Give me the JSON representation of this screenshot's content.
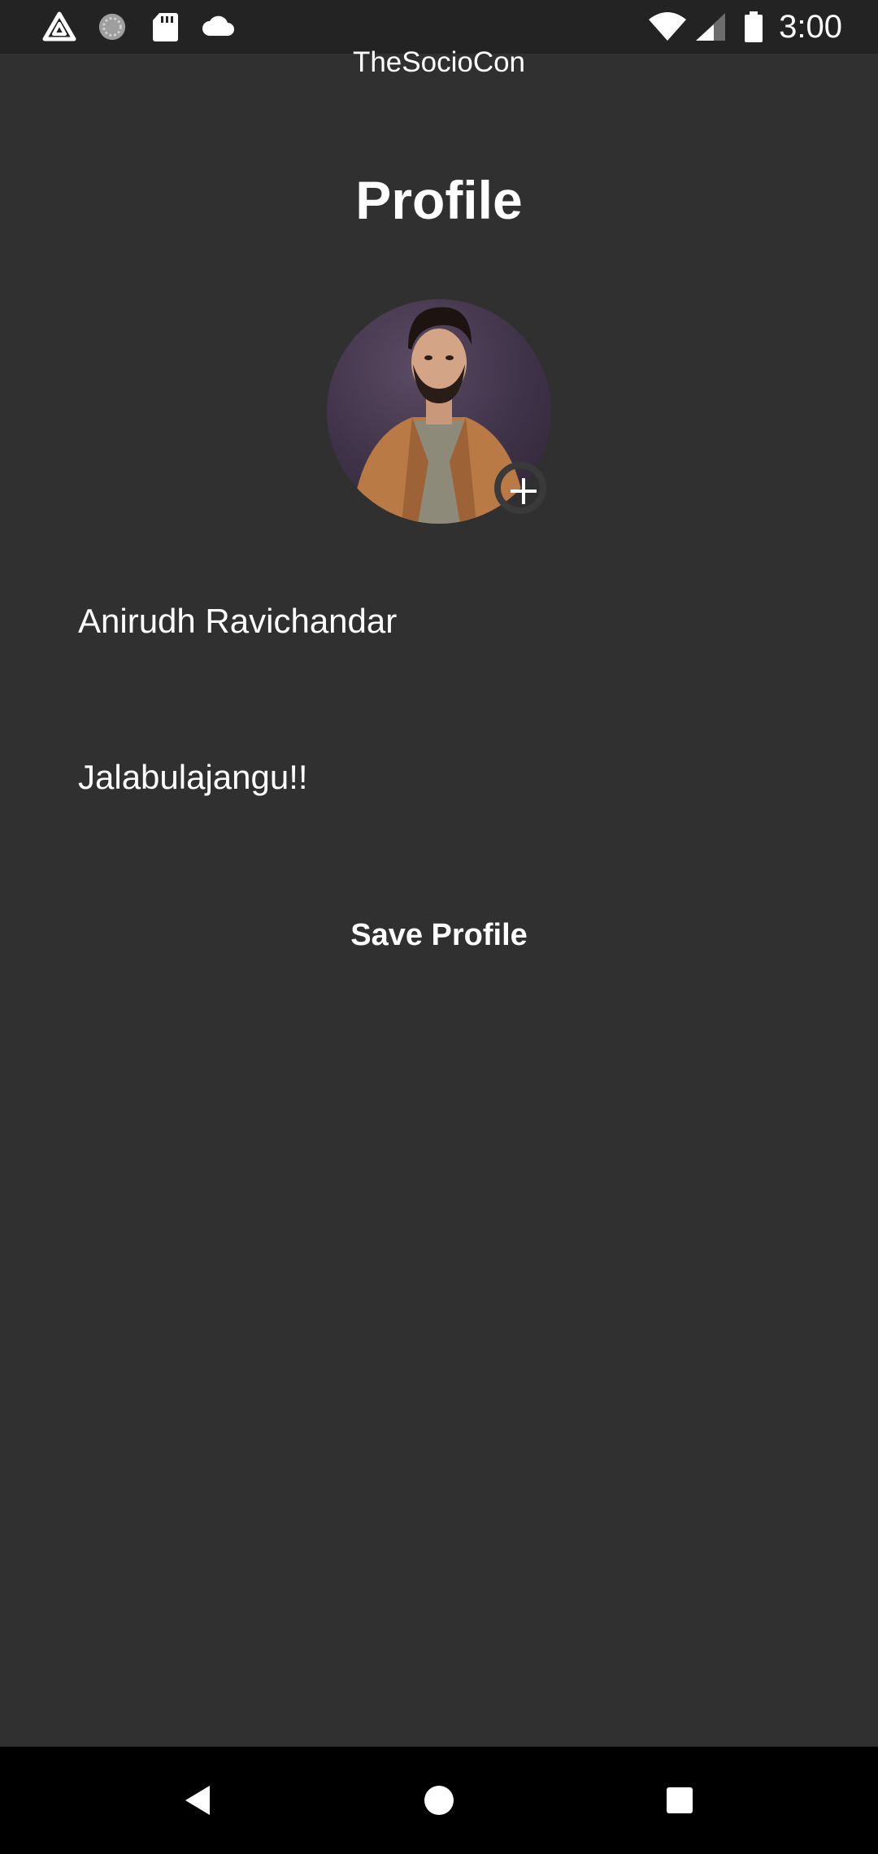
{
  "status_bar": {
    "time": "3:00",
    "icons": [
      "warning-triangle-icon",
      "sync-circle-icon",
      "sd-card-icon",
      "cloud-icon",
      "wifi-icon",
      "cell-signal-icon",
      "battery-icon"
    ]
  },
  "app": {
    "title": "TheSocioCon"
  },
  "profile": {
    "heading": "Profile",
    "name": "Anirudh Ravichandar",
    "status": "Jalabulajangu!!",
    "save_label": "Save Profile"
  },
  "nav_bar": {
    "icons": [
      "back-icon",
      "home-icon",
      "recents-icon"
    ]
  },
  "colors": {
    "background": "#303030",
    "status_bar": "#232323",
    "nav_bar": "#000000",
    "text": "#ffffff"
  }
}
